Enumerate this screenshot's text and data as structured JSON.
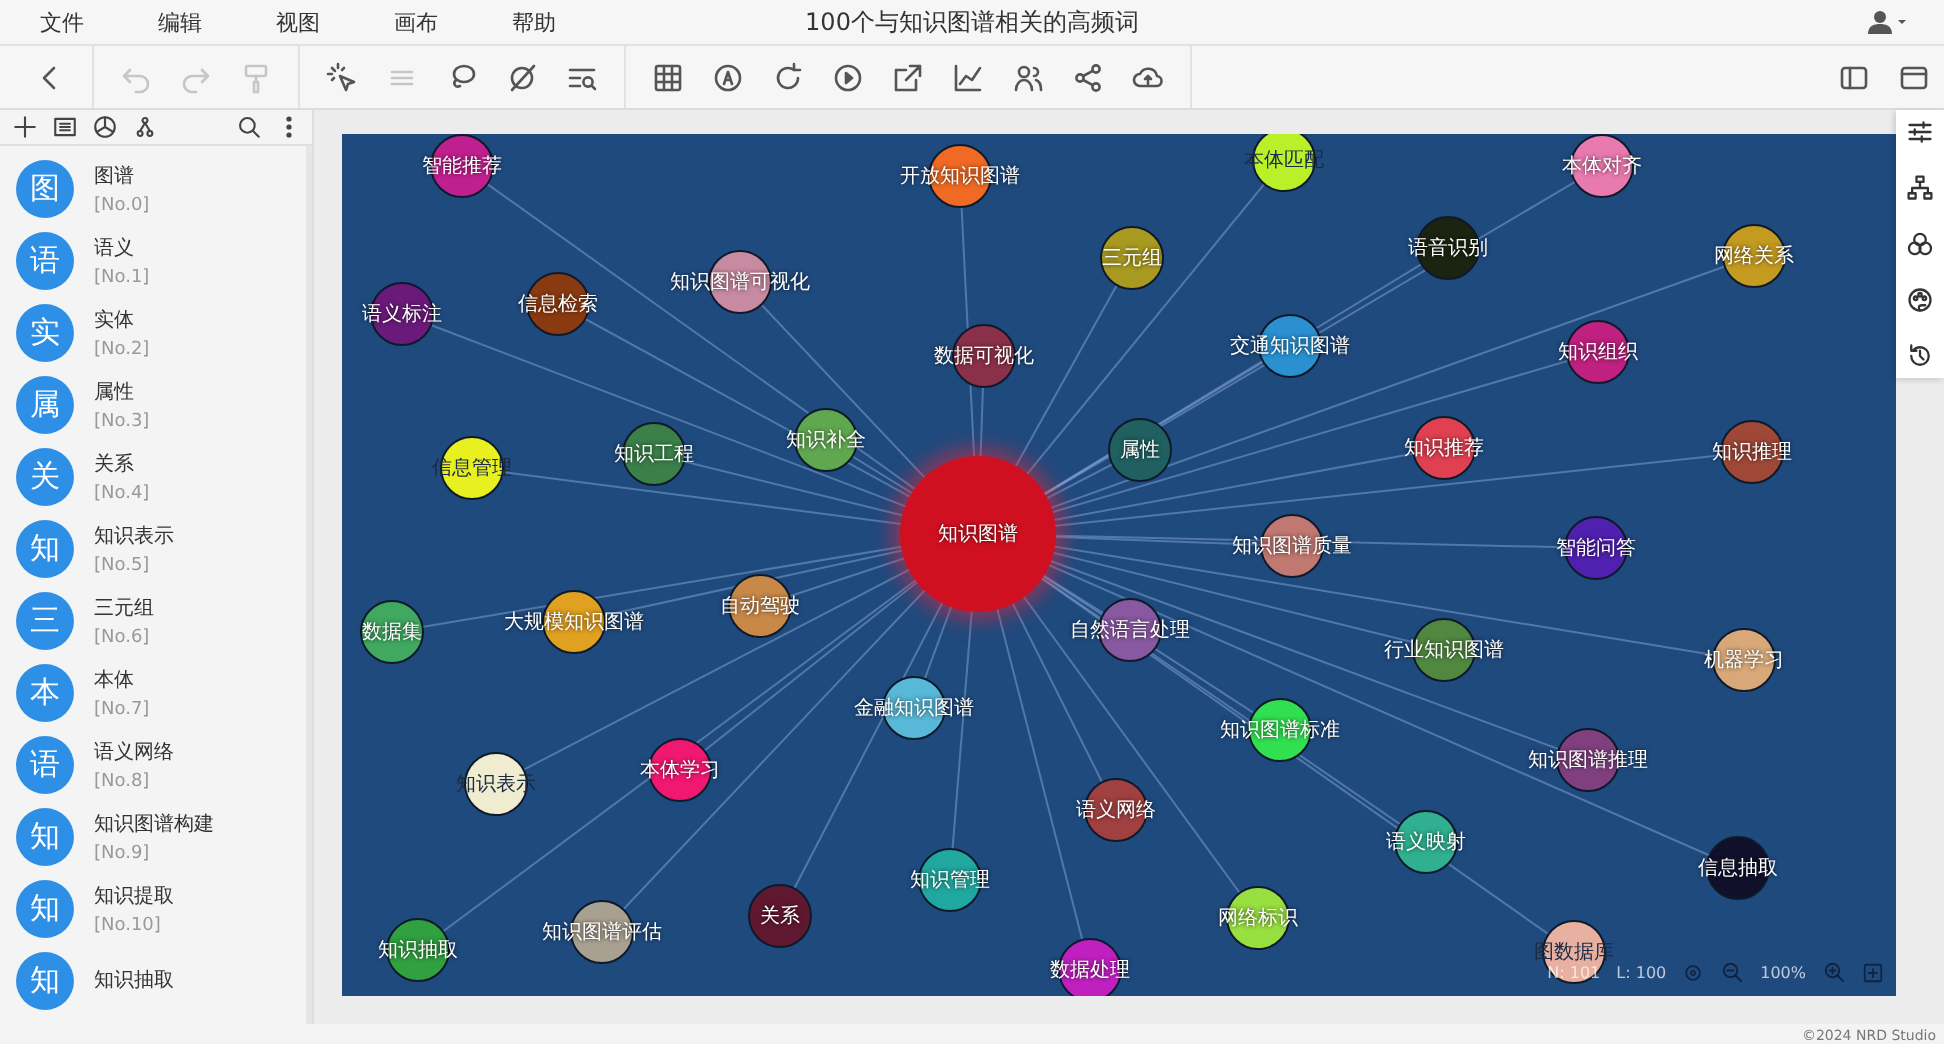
{
  "menu": [
    {
      "label": "文件"
    },
    {
      "label": "编辑"
    },
    {
      "label": "视图"
    },
    {
      "label": "画布"
    },
    {
      "label": "帮助"
    }
  ],
  "window": {
    "title": "100个与知识图谱相关的高频词"
  },
  "toolbar": [
    {
      "disabled": false
    },
    {
      "disabled": true
    },
    {
      "disabled": true
    },
    {
      "disabled": true
    },
    {
      "disabled": false
    },
    {
      "disabled": true
    },
    {
      "disabled": false
    },
    {
      "disabled": false
    },
    {
      "disabled": false
    },
    {
      "disabled": false
    },
    {
      "disabled": false
    },
    {
      "disabled": false
    },
    {
      "disabled": false
    },
    {
      "disabled": false
    },
    {
      "disabled": false
    },
    {
      "disabled": false
    },
    {
      "disabled": false
    },
    {
      "disabled": false
    },
    {
      "disabled": false
    },
    {
      "disabled": false
    }
  ],
  "sidebar": {
    "items": [
      {
        "avatar": "图",
        "name": "图谱",
        "number": "[No.0]"
      },
      {
        "avatar": "语",
        "name": "语义",
        "number": "[No.1]"
      },
      {
        "avatar": "实",
        "name": "实体",
        "number": "[No.2]"
      },
      {
        "avatar": "属",
        "name": "属性",
        "number": "[No.3]"
      },
      {
        "avatar": "关",
        "name": "关系",
        "number": "[No.4]"
      },
      {
        "avatar": "知",
        "name": "知识表示",
        "number": "[No.5]"
      },
      {
        "avatar": "三",
        "name": "三元组",
        "number": "[No.6]"
      },
      {
        "avatar": "本",
        "name": "本体",
        "number": "[No.7]"
      },
      {
        "avatar": "语",
        "name": "语义网络",
        "number": "[No.8]"
      },
      {
        "avatar": "知",
        "name": "知识图谱构建",
        "number": "[No.9]"
      },
      {
        "avatar": "知",
        "name": "知识提取",
        "number": "[No.10]"
      },
      {
        "avatar": "知",
        "name": "知识抽取"
      }
    ]
  },
  "graph": {
    "nodes": [
      {
        "label": "智能推荐",
        "color": "#c0208f",
        "kind": "node"
      },
      {
        "label": "开放知识图谱",
        "color": "#f06a24",
        "kind": "node"
      },
      {
        "label": "本体匹配",
        "color": "#b9f02a",
        "kind": "node"
      },
      {
        "label": "本体对齐",
        "color": "#e87ab0",
        "kind": "node"
      },
      {
        "label": "三元组",
        "color": "#a89a20",
        "kind": "node"
      },
      {
        "label": "语音识别",
        "color": "#1a2410",
        "kind": "node"
      },
      {
        "label": "网络关系",
        "color": "#c49a20",
        "kind": "node"
      },
      {
        "label": "语义标注",
        "color": "#6a1a7a",
        "kind": "node"
      },
      {
        "label": "信息检索",
        "color": "#8a3a10",
        "kind": "node"
      },
      {
        "label": "知识图谱可视化",
        "color": "#c88aa0",
        "kind": "node"
      },
      {
        "label": "数据可视化",
        "color": "#8a3048",
        "kind": "node"
      },
      {
        "label": "交通知识图谱",
        "color": "#2a90d0",
        "kind": "node"
      },
      {
        "label": "知识组织",
        "color": "#c02080",
        "kind": "node"
      },
      {
        "label": "属性",
        "color": "#206060",
        "kind": "node"
      },
      {
        "label": "知识推荐",
        "color": "#e04050",
        "kind": "node"
      },
      {
        "label": "知识推理",
        "color": "#a04838",
        "kind": "node"
      },
      {
        "label": "信息管理",
        "color": "#e8f020",
        "kind": "node"
      },
      {
        "label": "知识工程",
        "color": "#3a8048",
        "kind": "node"
      },
      {
        "label": "知识补全",
        "color": "#60a850",
        "kind": "node"
      },
      {
        "label": "知识图谱",
        "color": "#d01020",
        "kind": "hub"
      },
      {
        "label": "知识图谱质量",
        "color": "#c07870",
        "kind": "node"
      },
      {
        "label": "智能问答",
        "color": "#5020b0",
        "kind": "node"
      },
      {
        "label": "数据集",
        "color": "#40a860",
        "kind": "node"
      },
      {
        "label": "大规模知识图谱",
        "color": "#e0a020",
        "kind": "node"
      },
      {
        "label": "自动驾驶",
        "color": "#c88848",
        "kind": "node"
      },
      {
        "label": "自然语言处理",
        "color": "#8858a0",
        "kind": "node"
      },
      {
        "label": "行业知识图谱",
        "color": "#508840",
        "kind": "node"
      },
      {
        "label": "机器学习",
        "color": "#d8a878",
        "kind": "node"
      },
      {
        "label": "金融知识图谱",
        "color": "#58b8d8",
        "kind": "node"
      },
      {
        "label": "知识图谱标准",
        "color": "#30e050",
        "kind": "node"
      },
      {
        "label": "知识图谱推理",
        "color": "#804080",
        "kind": "node"
      },
      {
        "label": "知识表示",
        "color": "#f0ecd0",
        "kind": "node"
      },
      {
        "label": "本体学习",
        "color": "#f01870",
        "kind": "node"
      },
      {
        "label": "语义网络",
        "color": "#a04040",
        "kind": "node"
      },
      {
        "label": "语义映射",
        "color": "#30b090",
        "kind": "node"
      },
      {
        "label": "信息抽取",
        "color": "#10102a",
        "kind": "node"
      },
      {
        "label": "知识管理",
        "color": "#20a8a0",
        "kind": "node"
      },
      {
        "label": "关系",
        "color": "#601830",
        "kind": "node"
      },
      {
        "label": "知识抽取",
        "color": "#30a040",
        "kind": "node"
      },
      {
        "label": "知识图谱评估",
        "color": "#a8a090",
        "kind": "node"
      },
      {
        "label": "网络标识",
        "color": "#98e040",
        "kind": "node"
      },
      {
        "label": "图数据库",
        "color": "#e8b0a0",
        "kind": "node"
      },
      {
        "label": "数据处理",
        "color": "#c020c0",
        "kind": "node"
      }
    ],
    "status": {
      "nodes": "N: 101",
      "links": "L: 100",
      "zoom": "100%"
    }
  },
  "footer": {
    "copyright": "©2024 NRD Studio"
  }
}
